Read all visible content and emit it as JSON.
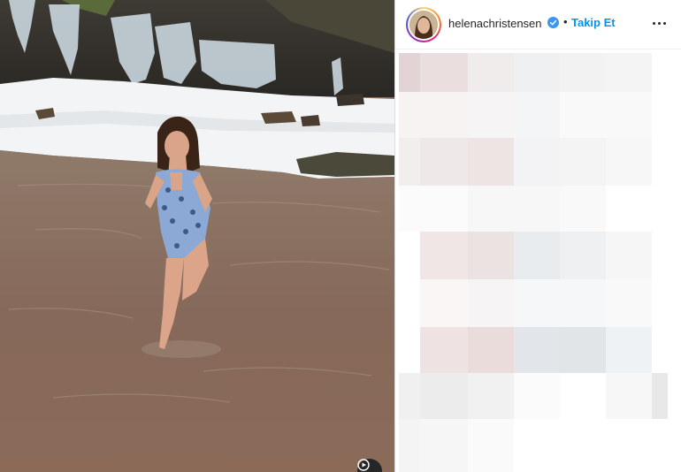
{
  "post": {
    "username": "helenachristensen",
    "separator": "•",
    "follow_label": "Takip Et"
  },
  "icons": {
    "verified": "verified-badge-icon",
    "more": "more-options-icon",
    "reel": "reel-icon"
  },
  "colors": {
    "follow": "#0095f6",
    "verified": "#3897f0",
    "text": "#262626"
  }
}
